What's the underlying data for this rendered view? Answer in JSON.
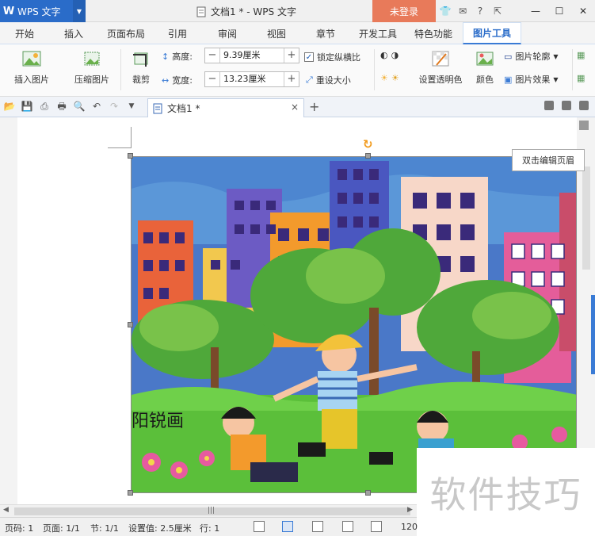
{
  "titlebar": {
    "app_name": "WPS 文字",
    "doc_title": "文档1 * - WPS 文字",
    "login": "未登录",
    "help": "?"
  },
  "menu": {
    "tabs": [
      "开始",
      "插入",
      "页面布局",
      "引用",
      "审阅",
      "视图",
      "章节",
      "开发工具",
      "特色功能",
      "图片工具"
    ],
    "active_tab": "图片工具"
  },
  "ribbon": {
    "insert_picture": "插入图片",
    "compress_picture": "压缩图片",
    "crop": "裁剪",
    "height_label": "高度:",
    "height_value": "9.39厘米",
    "width_label": "宽度:",
    "width_value": "13.23厘米",
    "lock_ratio": "锁定纵横比",
    "lock_ratio_checked": true,
    "reset_size": "重设大小",
    "set_transparent": "设置透明色",
    "color": "颜色",
    "picture_outline": "图片轮廓",
    "picture_effect": "图片效果",
    "minus": "−",
    "plus": "+"
  },
  "doc_tab": {
    "name": "文档1 *",
    "close": "×",
    "new_tab": "+"
  },
  "document": {
    "tooltip": "双击编辑页眉",
    "painting_signature": "阳锐画"
  },
  "watermark": "软件技巧",
  "statusbar": {
    "page_num": "页码: 1",
    "page": "页面: 1/1",
    "section": "节: 1/1",
    "set_value": "设置值: 2.5厘米",
    "line": "行: 1",
    "zoom": "120"
  },
  "colors": {
    "app_blue": "#2a6cc9",
    "login_orange": "#e87a5a",
    "rotate_handle": "#f29c1f"
  }
}
